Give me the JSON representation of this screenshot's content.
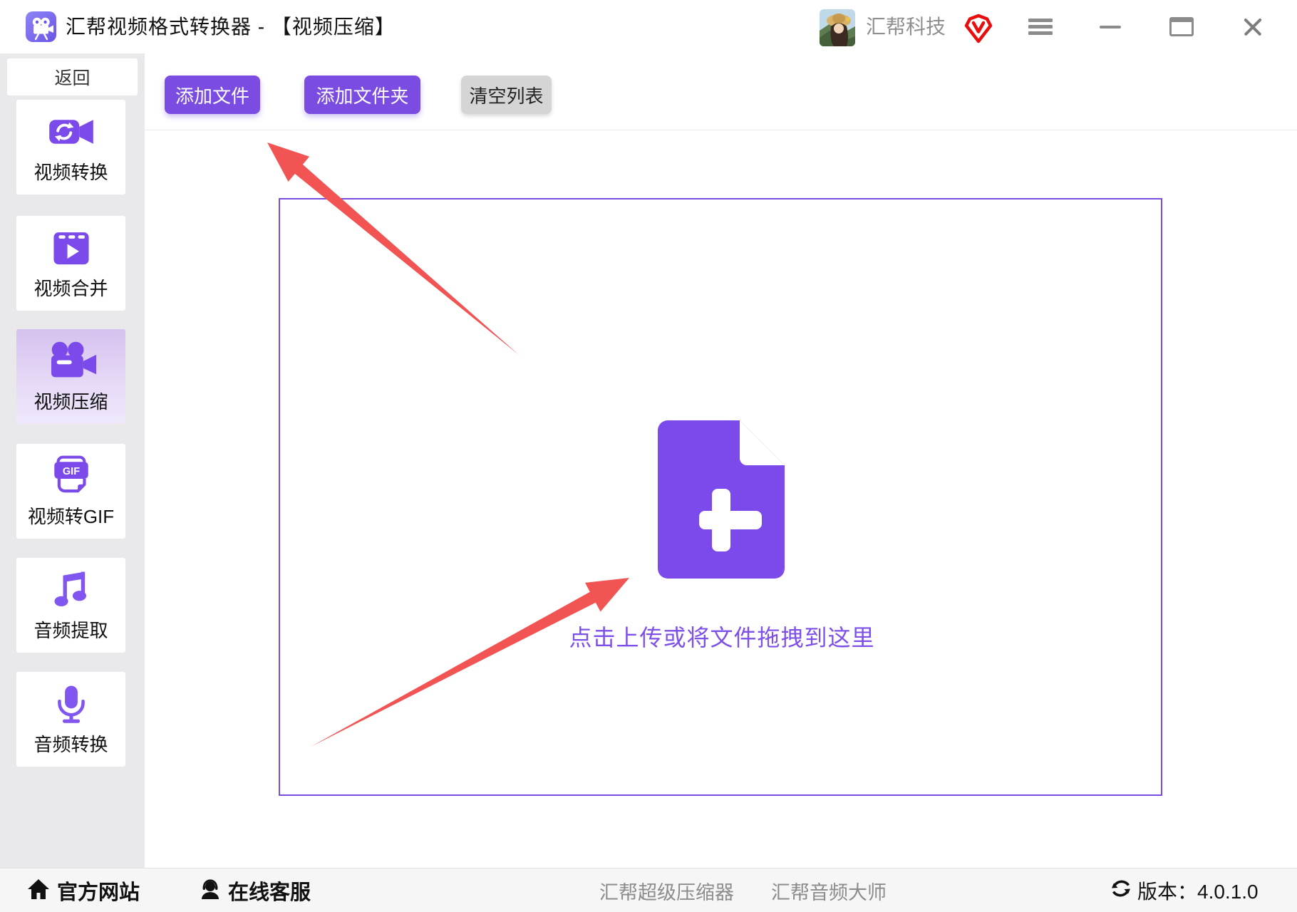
{
  "window": {
    "title": "汇帮视频格式转换器  -  【视频压缩】",
    "account_name": "汇帮科技"
  },
  "sidebar": {
    "back_label": "返回",
    "items": [
      {
        "label": "视频转换",
        "icon": "video-convert-icon",
        "selected": false
      },
      {
        "label": "视频合并",
        "icon": "video-merge-icon",
        "selected": false
      },
      {
        "label": "视频压缩",
        "icon": "video-compress-icon",
        "selected": true
      },
      {
        "label": "视频转GIF",
        "icon": "video-to-gif-icon",
        "selected": false
      },
      {
        "label": "音频提取",
        "icon": "audio-extract-icon",
        "selected": false
      },
      {
        "label": "音频转换",
        "icon": "audio-convert-icon",
        "selected": false
      }
    ]
  },
  "toolbar": {
    "add_file_label": "添加文件",
    "add_folder_label": "添加文件夹",
    "clear_list_label": "清空列表"
  },
  "upload_area": {
    "hint": "点击上传或将文件拖拽到这里"
  },
  "footer": {
    "official_site_label": "官方网站",
    "online_service_label": "在线客服",
    "links": [
      {
        "label": "汇帮超级压缩器"
      },
      {
        "label": "汇帮音频大师"
      }
    ],
    "version_label": "版本：4.0.1.0"
  },
  "gif_icon_text": "GIF",
  "colors": {
    "accent_purple": "#7b4ce2",
    "icon_purple": "#7c49ea",
    "selected_tile_gradient_top": "#d4c1ee",
    "selected_tile_gradient_bottom": "#efe8fb",
    "arrow_red": "#f25353",
    "vip_red": "#e90d0d",
    "footer_link_gray": "#8c8c8c"
  }
}
